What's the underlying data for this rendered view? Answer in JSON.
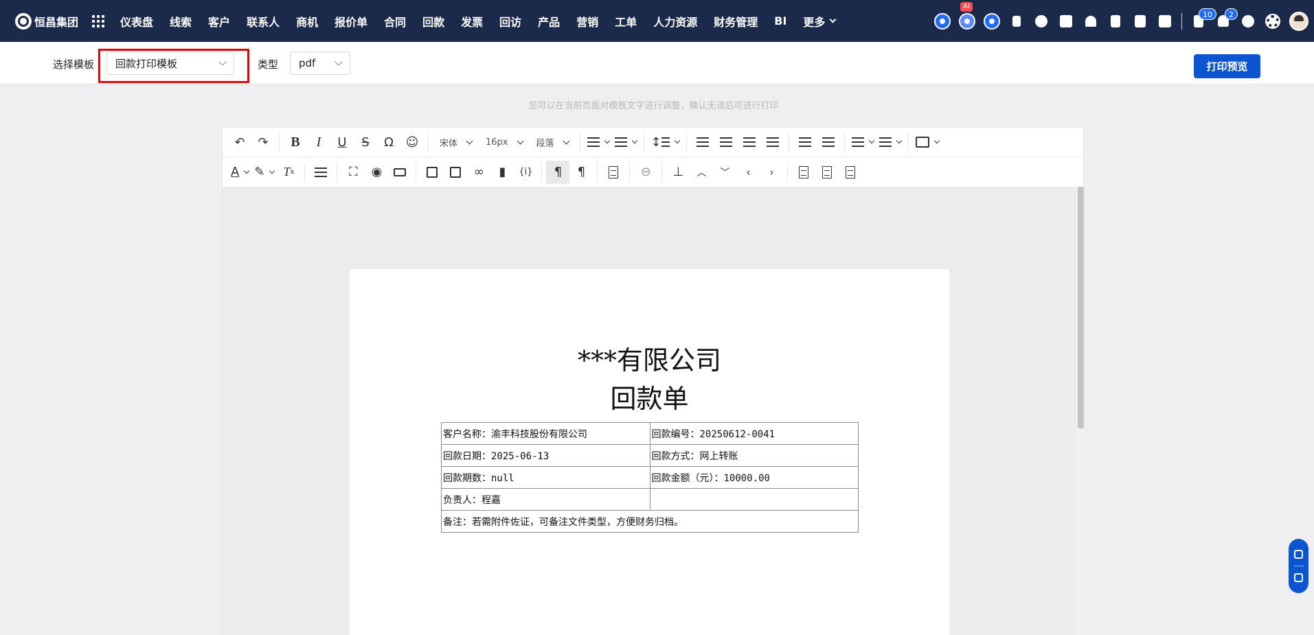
{
  "brand": {
    "name": "恒昌集团"
  },
  "nav": {
    "items": [
      "仪表盘",
      "线索",
      "客户",
      "联系人",
      "商机",
      "报价单",
      "合同",
      "回款",
      "发票",
      "回访",
      "产品",
      "营销",
      "工单",
      "人力资源",
      "财务管理",
      "BI"
    ],
    "more": "更多"
  },
  "header_right": {
    "ai_badge": "AI",
    "task_count": "10",
    "notification_count": "2",
    "icons": [
      "add-circle-icon",
      "ai-robot-icon",
      "chat-icon",
      "pin-icon",
      "globe-icon",
      "calendar-check-icon",
      "user-stamp-icon",
      "document-icon",
      "phone-icon",
      "calendar-icon",
      "task-icon",
      "bell-icon",
      "help-icon",
      "gear-icon",
      "avatar"
    ]
  },
  "toolbar_top": {
    "template_label": "选择模板",
    "template_value": "回款打印模板",
    "type_label": "类型",
    "type_value": "pdf",
    "print_preview": "打印预览"
  },
  "hint": "您可以在当前页面对模板文字进行调整，确认无误后可进行打印",
  "editor": {
    "font_family": "宋体",
    "font_size": "16px",
    "block_format": "段落",
    "toolbar_icons_row1": [
      "undo-icon",
      "redo-icon",
      "bold-icon",
      "italic-icon",
      "underline-icon",
      "strikethrough-icon",
      "special-char-icon",
      "emoji-icon",
      "line-height-icon",
      "align-left-icon",
      "align-center-icon",
      "align-right-icon",
      "justify-icon",
      "outdent-icon",
      "indent-icon",
      "ordered-list-icon",
      "bullet-list-icon",
      "table-icon"
    ],
    "toolbar_icons_row2": [
      "text-color-icon",
      "highlight-icon",
      "clear-format-icon",
      "page-break-icon",
      "fullscreen-icon",
      "preview-icon",
      "print-icon",
      "image-icon",
      "media-icon",
      "link-icon",
      "bookmark-icon",
      "template-var-icon",
      "ltr-icon",
      "rtl-icon",
      "paste-text-icon",
      "strike-box-icon",
      "stamp-icon",
      "chevron-up-icon",
      "chevron-down-icon",
      "chevron-left-icon",
      "chevron-right-icon",
      "blank-doc-icon",
      "doc-lines-icon",
      "doc-text-icon"
    ]
  },
  "document": {
    "title": "***有限公司",
    "subtitle": "回款单",
    "rows": [
      [
        "客户名称：渝丰科技股份有限公司",
        "回款编号：20250612-0041"
      ],
      [
        "回款日期：2025-06-13",
        "回款方式：网上转账"
      ],
      [
        "回款期数：null",
        "回款金额（元）：10000.00"
      ],
      [
        "负责人：程嘉",
        ""
      ]
    ],
    "note": "备注：若需附件佐证，可备注文件类型，方便财务归档。"
  },
  "colors": {
    "nav_bg": "#1b2a4a",
    "primary": "#0b56d0",
    "highlight": "#e60000"
  }
}
